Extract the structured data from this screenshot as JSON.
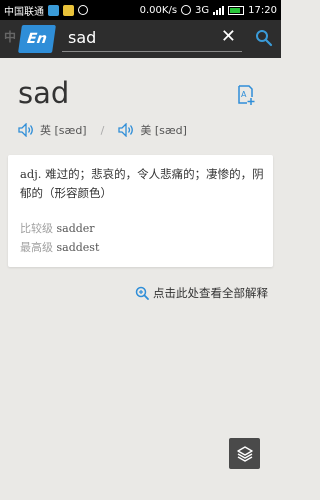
{
  "status_bar": {
    "carrier": "中国联通",
    "speed": "0.00K/s",
    "network": "3G",
    "time": "17:20"
  },
  "search": {
    "logo": "En",
    "logo_ghost": "中",
    "query": "sad",
    "clear_glyph": "✕"
  },
  "entry": {
    "word": "sad",
    "pron_uk": "英 [sæd]",
    "pron_us": "美 [sæd]",
    "pron_separator": "/",
    "definition": {
      "pos": "adj.",
      "text": "难过的；悲哀的，令人悲痛的；凄惨的，阴郁的（形容颜色）"
    },
    "forms": [
      {
        "label": "比较级",
        "value": "sadder"
      },
      {
        "label": "最高级",
        "value": "saddest"
      }
    ]
  },
  "more_link": "点击此处查看全部解释",
  "colors": {
    "accent": "#2f8ed8",
    "background": "#eae9e6",
    "toolbar": "#2d2d2d"
  }
}
